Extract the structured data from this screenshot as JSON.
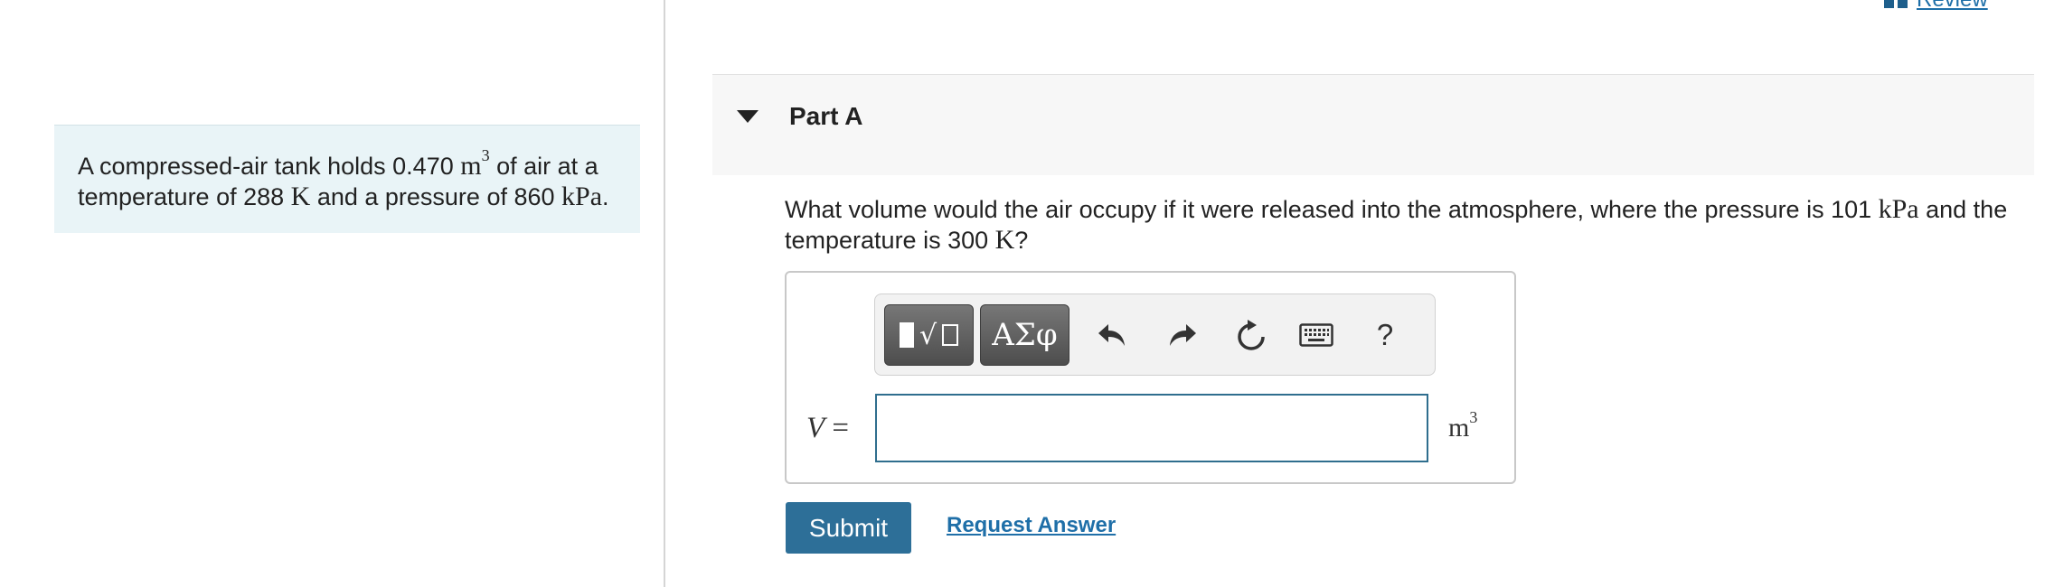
{
  "review": {
    "label": "Review"
  },
  "problem": {
    "text_1": "A compressed-air tank holds 0.470 ",
    "volume_unit_base": "m",
    "volume_unit_exp": "3",
    "text_2": " of air at a temperature of 288 ",
    "temp_unit": "K",
    "text_3": " and a pressure of 860 ",
    "pressure_unit": "kPa",
    "text_4": "."
  },
  "part": {
    "title": "Part A"
  },
  "question": {
    "text_1": "What volume would the air occupy if it were released into the atmosphere, where the pressure is 101 ",
    "pressure_unit": "kPa",
    "text_2": " and the temperature is 300 ",
    "temp_unit": "K",
    "text_3": "?"
  },
  "toolbar": {
    "greek_label": "ΑΣφ",
    "help_label": "?",
    "icons": [
      "templates-icon",
      "greek-letters-icon",
      "undo-icon",
      "redo-icon",
      "reset-icon",
      "keyboard-icon",
      "help-icon"
    ]
  },
  "answer": {
    "variable": "V",
    "equals": " =",
    "value": "",
    "unit_base": "m",
    "unit_exp": "3"
  },
  "actions": {
    "submit_label": "Submit",
    "request_label": "Request Answer"
  },
  "colors": {
    "accent": "#2d6f98",
    "link": "#1f6fa8",
    "problem_bg": "#e9f4f7",
    "part_header_bg": "#f7f7f7"
  }
}
